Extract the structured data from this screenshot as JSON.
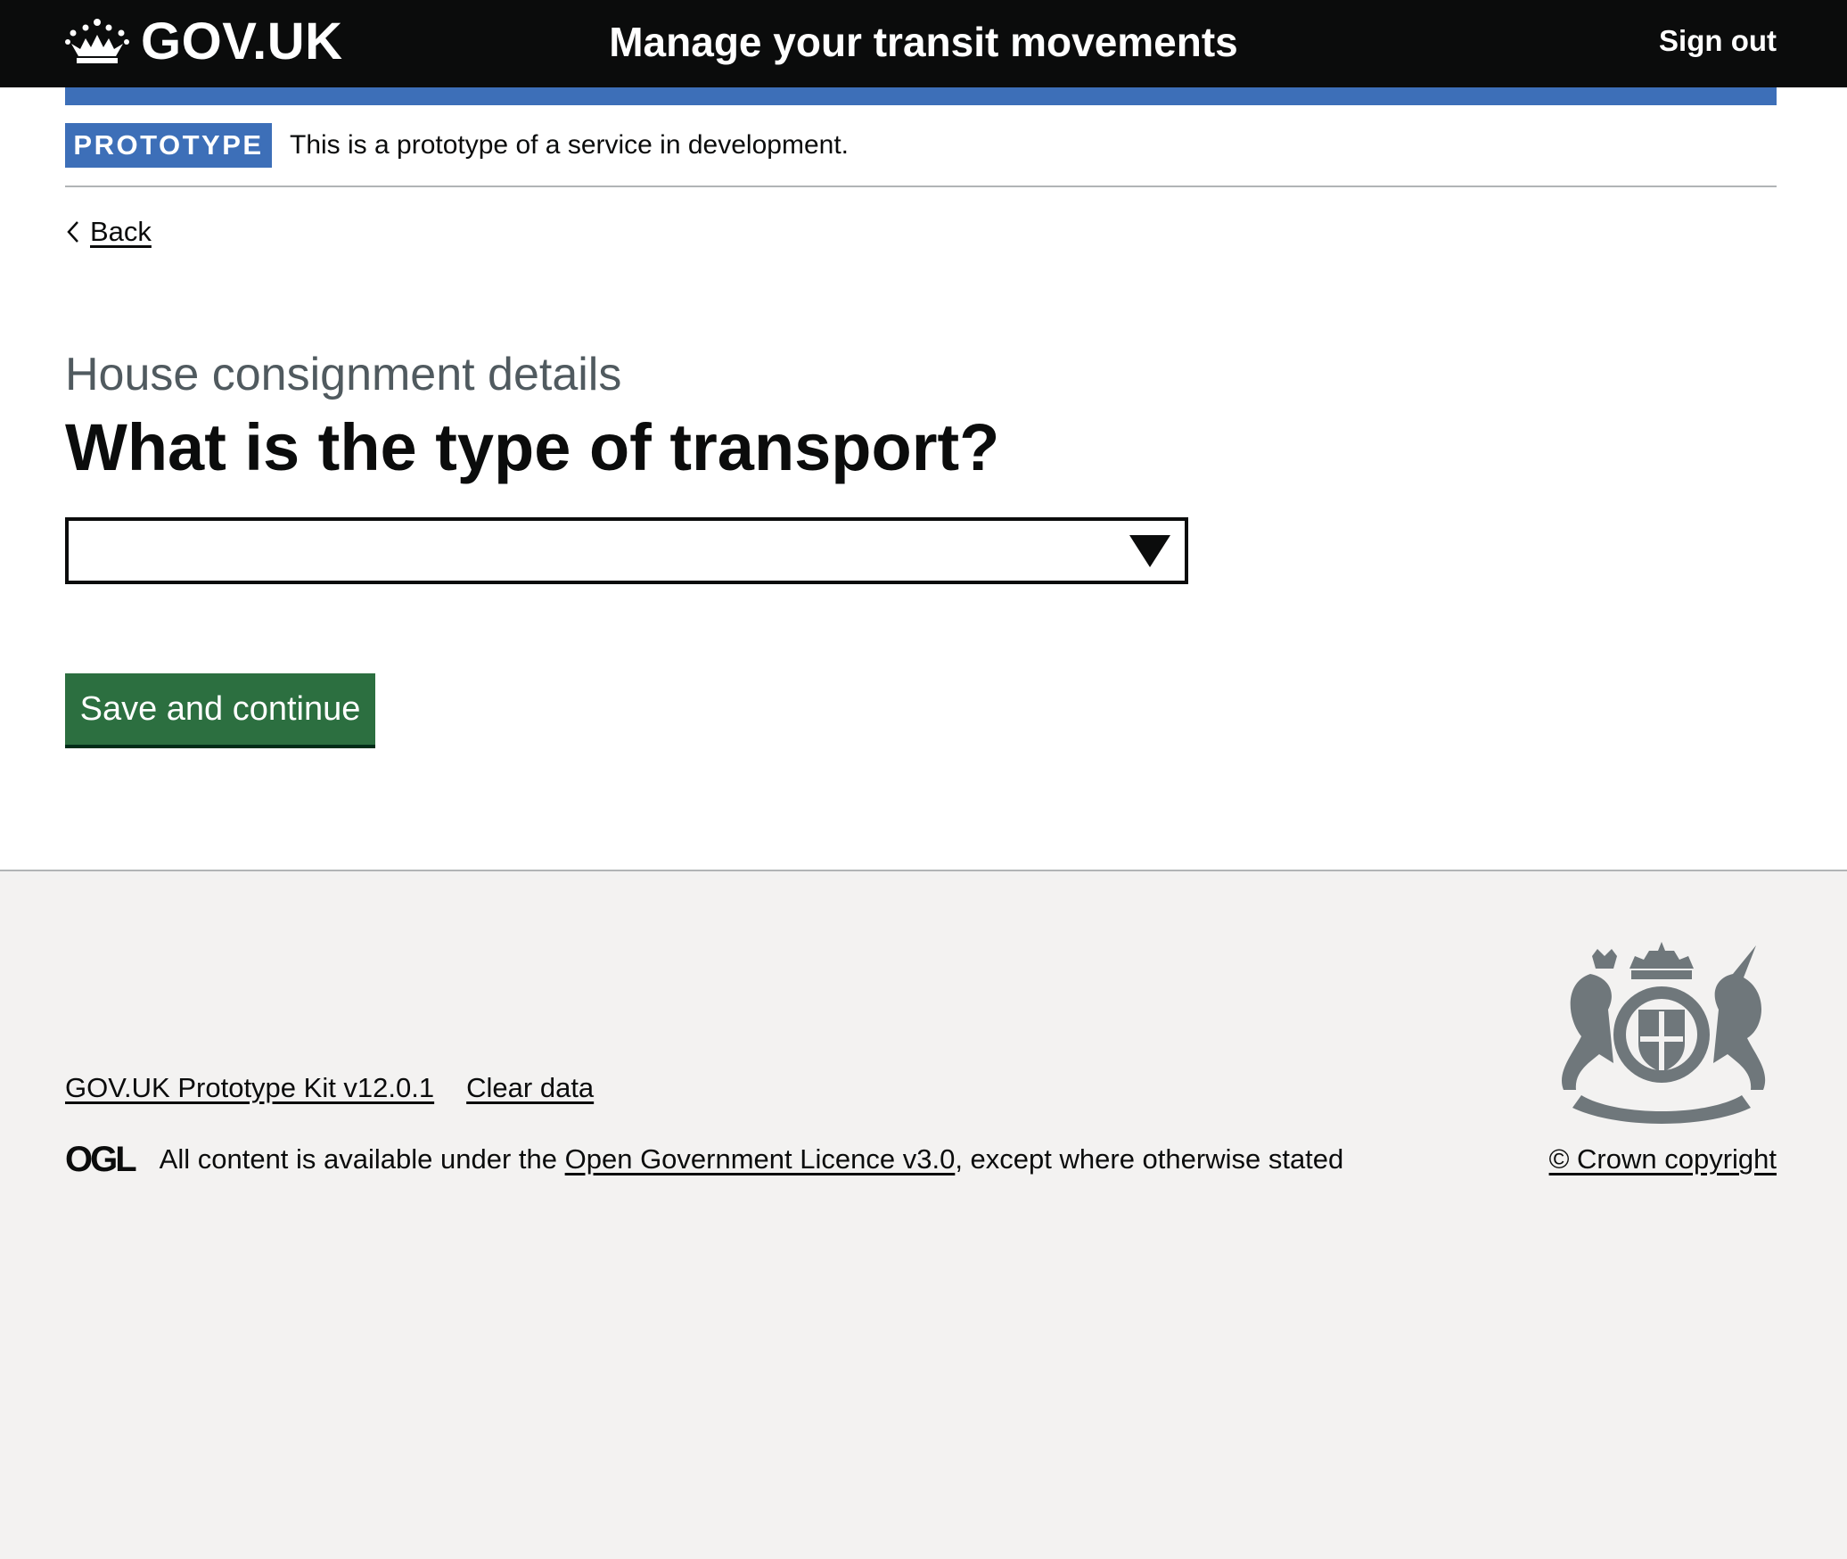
{
  "header": {
    "logo_text": "GOV.UK",
    "service_name": "Manage your transit movements",
    "sign_out": "Sign out"
  },
  "phase_banner": {
    "tag": "PROTOTYPE",
    "text": "This is a prototype of a service in development."
  },
  "back_link": "Back",
  "form": {
    "caption": "House consignment details",
    "heading": "What is the type of transport?",
    "select_value": "",
    "submit_label": "Save and continue"
  },
  "footer": {
    "links": [
      "GOV.UK Prototype Kit v12.0.1",
      "Clear data"
    ],
    "ogl_logo": "OGL",
    "licence_prefix": "All content is available under the ",
    "licence_link": "Open Government Licence v3.0",
    "licence_suffix": ", except where otherwise stated",
    "copyright": "© Crown copyright"
  },
  "colors": {
    "header_bg": "#0b0c0c",
    "accent_blue": "#3d6fb8",
    "button_green": "#2c6f40",
    "footer_bg": "#f3f2f1"
  },
  "icons": {
    "logo": "crown-icon",
    "back": "chevron-left-icon",
    "select": "triangle-down-icon",
    "crest": "royal-coat-of-arms-icon"
  }
}
